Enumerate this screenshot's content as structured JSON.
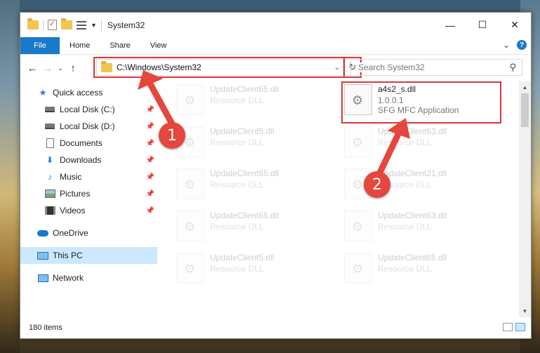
{
  "window": {
    "title": "System32",
    "controls": {
      "minimize": "—",
      "maximize": "☐",
      "close": "✕"
    }
  },
  "ribbon": {
    "tabs": [
      "File",
      "Home",
      "Share",
      "View"
    ]
  },
  "nav": {
    "address": "C:\\Windows\\System32",
    "search_placeholder": "Search System32"
  },
  "sidebar": {
    "quick_access": "Quick access",
    "items": [
      {
        "label": "Local Disk (C:)",
        "icon": "drive-icon"
      },
      {
        "label": "Local Disk (D:)",
        "icon": "drive-icon"
      },
      {
        "label": "Documents",
        "icon": "documents-icon"
      },
      {
        "label": "Downloads",
        "icon": "downloads-icon"
      },
      {
        "label": "Music",
        "icon": "music-icon"
      },
      {
        "label": "Pictures",
        "icon": "pictures-icon"
      },
      {
        "label": "Videos",
        "icon": "videos-icon"
      }
    ],
    "onedrive": "OneDrive",
    "thispc": "This PC",
    "network": "Network"
  },
  "files": {
    "highlighted": {
      "name": "a4s2_s.dll",
      "version": "1.0.0.1",
      "description": "SFG MFC Application"
    },
    "left_col": [
      {
        "name": "UpdateClient65.dll",
        "type": "Resource DLL"
      },
      {
        "name": "UpdateClient5.dll",
        "type": "Resource DLL"
      },
      {
        "name": "UpdateClient65.dll",
        "type": "Resource DLL"
      },
      {
        "name": "UpdateClient65.dll",
        "type": "Resource DLL"
      },
      {
        "name": "UpdateClient5.dll",
        "type": "Resource DLL"
      }
    ],
    "right_col": [
      {
        "name": "UpdateClient63.dll",
        "type": "Resource DLL"
      },
      {
        "name": "UpdateClient21.dll",
        "type": "Resource DLL"
      },
      {
        "name": "UpdateClient63.dll",
        "type": "Resource DLL"
      },
      {
        "name": "UpdateClient65.dll",
        "type": "Resource DLL"
      }
    ]
  },
  "status": {
    "count": "180 items"
  },
  "annotations": {
    "badge1": "1",
    "badge2": "2",
    "color": "#e5463d"
  }
}
